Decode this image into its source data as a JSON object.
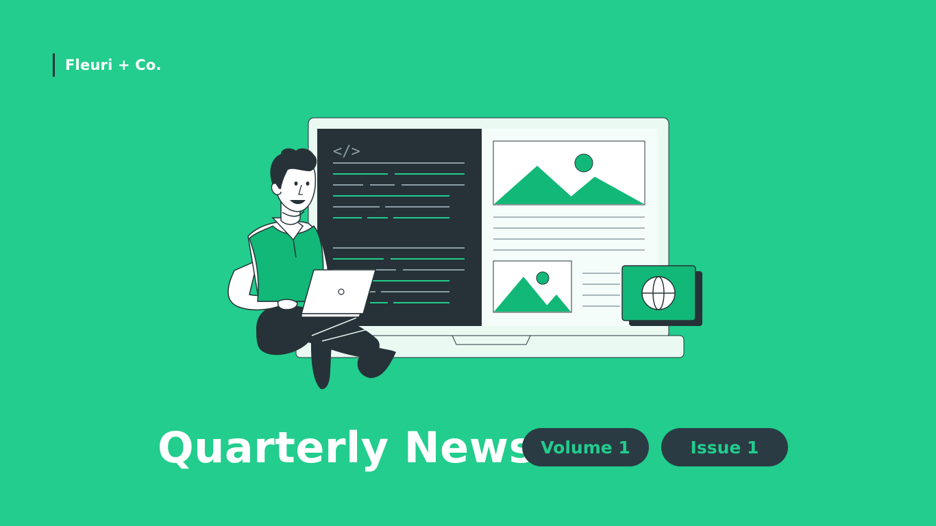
{
  "brand": {
    "name": "Fleuri + Co."
  },
  "hero": {
    "code_icon_label": "</>"
  },
  "title": "Quarterly News",
  "badges": {
    "volume": "Volume 1",
    "issue": "Issue 1"
  },
  "colors": {
    "background": "#22cd8d",
    "dark": "#263238",
    "light": "#eafaf3",
    "accent": "#12b877"
  },
  "icons": [
    "code-icon",
    "image-icon",
    "globe-icon",
    "laptop-icon"
  ]
}
